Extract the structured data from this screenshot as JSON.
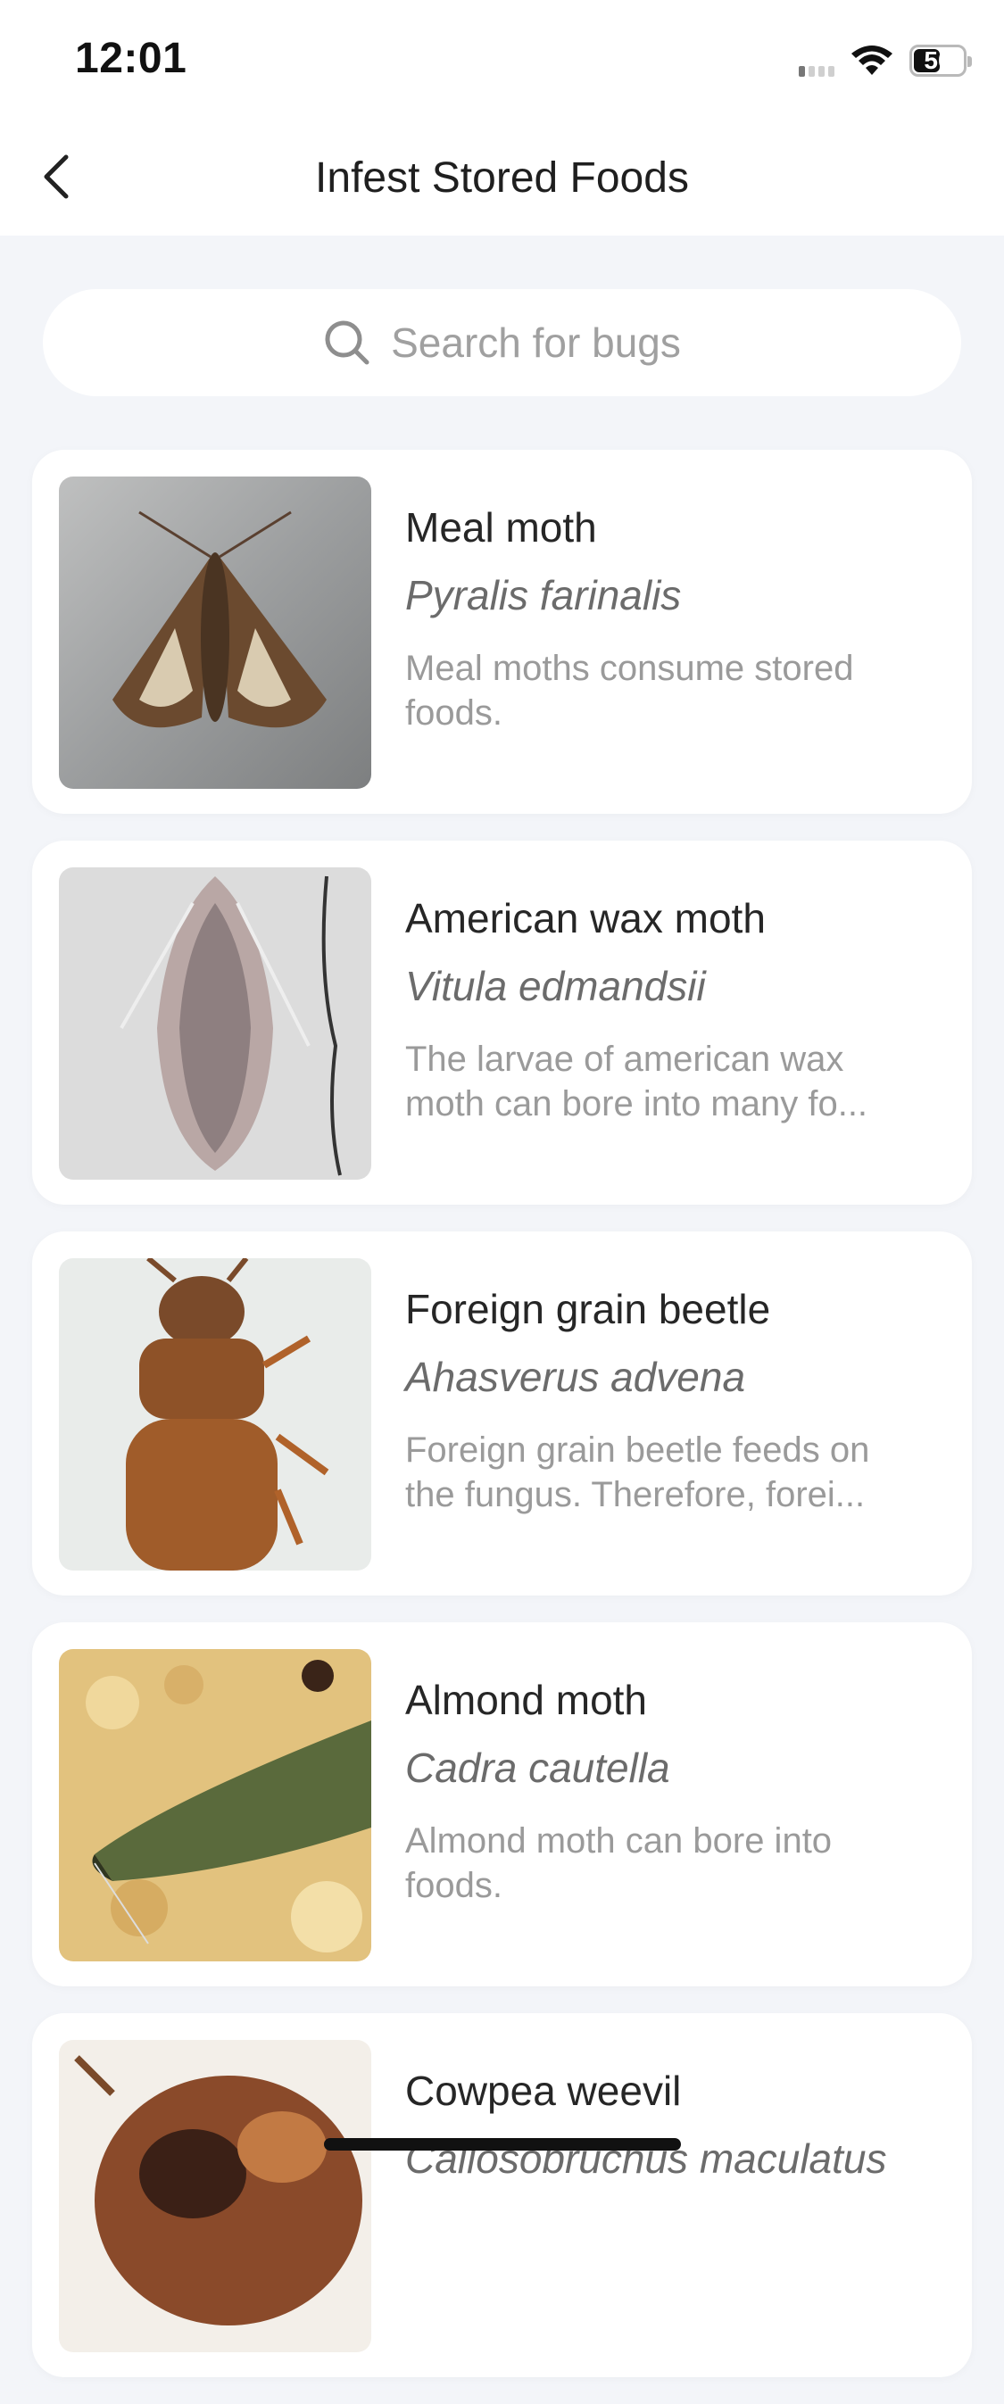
{
  "status": {
    "time": "12:01",
    "battery": "50",
    "battery_level_percent": 50
  },
  "nav": {
    "title": "Infest Stored Foods",
    "back_icon": "chevron-left-icon"
  },
  "search": {
    "placeholder": "Search for bugs",
    "icon": "search-icon"
  },
  "bugs": [
    {
      "common_name": "Meal moth",
      "scientific_name": "Pyralis farinalis",
      "description": "Meal moths consume stored foods."
    },
    {
      "common_name": "American wax moth",
      "scientific_name": "Vitula edmandsii",
      "description": "The larvae of american wax moth can bore into many fo..."
    },
    {
      "common_name": "Foreign grain beetle",
      "scientific_name": "Ahasverus advena",
      "description": "Foreign grain beetle feeds on the fungus. Therefore, forei..."
    },
    {
      "common_name": "Almond moth",
      "scientific_name": "Cadra cautella",
      "description": "Almond moth can bore into foods."
    },
    {
      "common_name": "Cowpea weevil",
      "scientific_name": "Callosobruchus maculatus",
      "description": ""
    }
  ]
}
